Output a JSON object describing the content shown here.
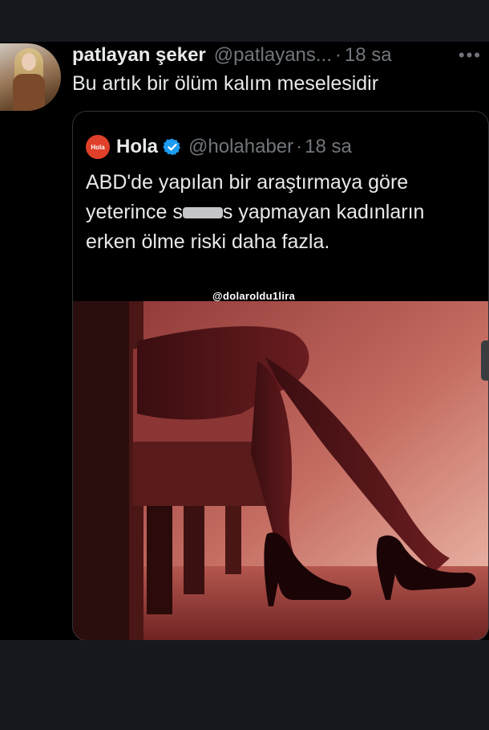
{
  "tweet": {
    "author_name": "patlayan şeker",
    "author_handle": "@patlayans...",
    "dot": "·",
    "time": "18 sa",
    "more_icon": "more-horizontal-icon",
    "text": "Bu artık bir ölüm kalım meselesidir"
  },
  "quote": {
    "logo_text": "Hola",
    "name": "Hola",
    "verified_icon": "verified-badge-icon",
    "handle": "@holahaber",
    "dot": "·",
    "time": "18 sa",
    "text_before": "ABD'de yapılan bir araştırmaya göre yeterince s",
    "text_after": "s yapmayan kadınların erken ölme riski daha fazla."
  },
  "media": {
    "watermark": "@dolaroldu1lira"
  },
  "colors": {
    "background": "#000000",
    "band": "#15191e",
    "text_primary": "#e7e9ea",
    "text_secondary": "#71767b",
    "verified": "#1d9bf0",
    "hola_brand": "#e0402a"
  }
}
